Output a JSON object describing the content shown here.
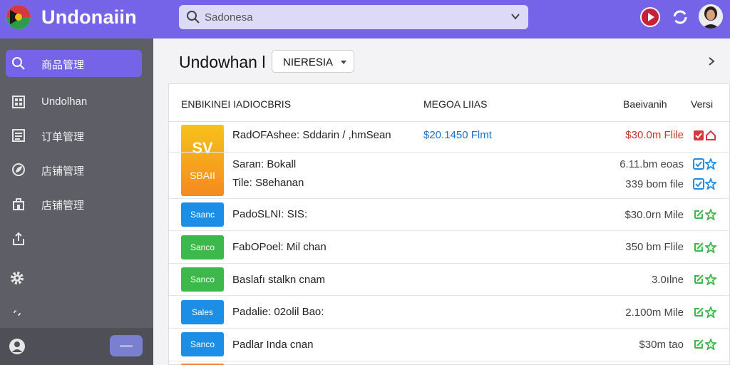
{
  "app": {
    "title": "Undonaiin"
  },
  "search": {
    "placeholder": "Sadonesa"
  },
  "sidebar": {
    "items": [
      {
        "label": "商品管理",
        "icon": "search-icon"
      },
      {
        "label": "Undolhan",
        "icon": "grid-icon"
      },
      {
        "label": "订单管理",
        "icon": "list-icon"
      },
      {
        "label": "店铺管理",
        "icon": "leaf-icon"
      },
      {
        "label": "店铺管理",
        "icon": "shop-icon"
      },
      {
        "label": "",
        "icon": "upload-icon"
      },
      {
        "label": "",
        "icon": "gear-icon"
      },
      {
        "label": "",
        "icon": "link-icon"
      }
    ],
    "collapse_label": "—"
  },
  "main": {
    "title": "Undowhan l",
    "dropdown": {
      "selected": "NIERESIA"
    }
  },
  "table": {
    "columns": [
      "ENBIKINEI IADIOCBRIS",
      "MEGOA LIIAS",
      "Baeivanih",
      "Versi"
    ],
    "rows": [
      {
        "badge_main": "SV",
        "badge_sub": "SBAII",
        "badge_color": "#f7a21b",
        "name": "RadOFAshee: Sddarin / ,hmSean",
        "info": "$20.1450 Flmt",
        "price": "$30.0m Flile",
        "status": "red"
      },
      {
        "name": "Saran: Bokall",
        "price": "6.11.bm eoas",
        "status": "blue"
      },
      {
        "name": "Tile: S8ehanan",
        "price": "339 bom file",
        "status": "blue"
      },
      {
        "badge_main": "Saanc",
        "badge_color": "#1d8ee6",
        "name": "PadoSLNI: SIS:",
        "price": "$30.0rn Mile",
        "status": "green"
      },
      {
        "badge_main": "Sanco",
        "badge_color": "#3db84a",
        "name": "FabOPoel: Mil chan",
        "price": "350 bm Flile",
        "status": "green"
      },
      {
        "badge_main": "Sanco",
        "badge_color": "#3db84a",
        "name": "Baslafı stalkn cnam",
        "price": "3.0ılne",
        "status": "green"
      },
      {
        "badge_main": "Sales",
        "badge_color": "#1d8ee6",
        "name": "Padalie: 02olil Bao:",
        "price": "2.100m Mile",
        "status": "green"
      },
      {
        "badge_main": "Sanco",
        "badge_color": "#1d8ee6",
        "name": "Padlar Inda cnan",
        "price": "$30m tao",
        "status": "green"
      }
    ]
  },
  "colors": {
    "accent": "#7563e8",
    "sidebar": "#5e5e66",
    "red": "#d6393b",
    "blue": "#1d8ee6",
    "green": "#3db84a"
  }
}
